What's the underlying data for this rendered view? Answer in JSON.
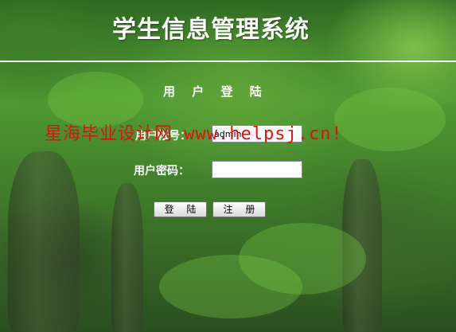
{
  "header": {
    "title": "学生信息管理系统"
  },
  "login": {
    "heading": "用 户 登 陆",
    "account_label": "用户帐号：",
    "account_value": "admin",
    "password_label": "用户密码：",
    "password_value": "",
    "login_button": "登 陆",
    "register_button": "注 册"
  },
  "watermark": {
    "text": "星海毕业设计网 www.helpsj.cn!"
  },
  "colors": {
    "title_text": "#ffffff",
    "watermark": "#e01010",
    "background": "#4f9a33"
  }
}
